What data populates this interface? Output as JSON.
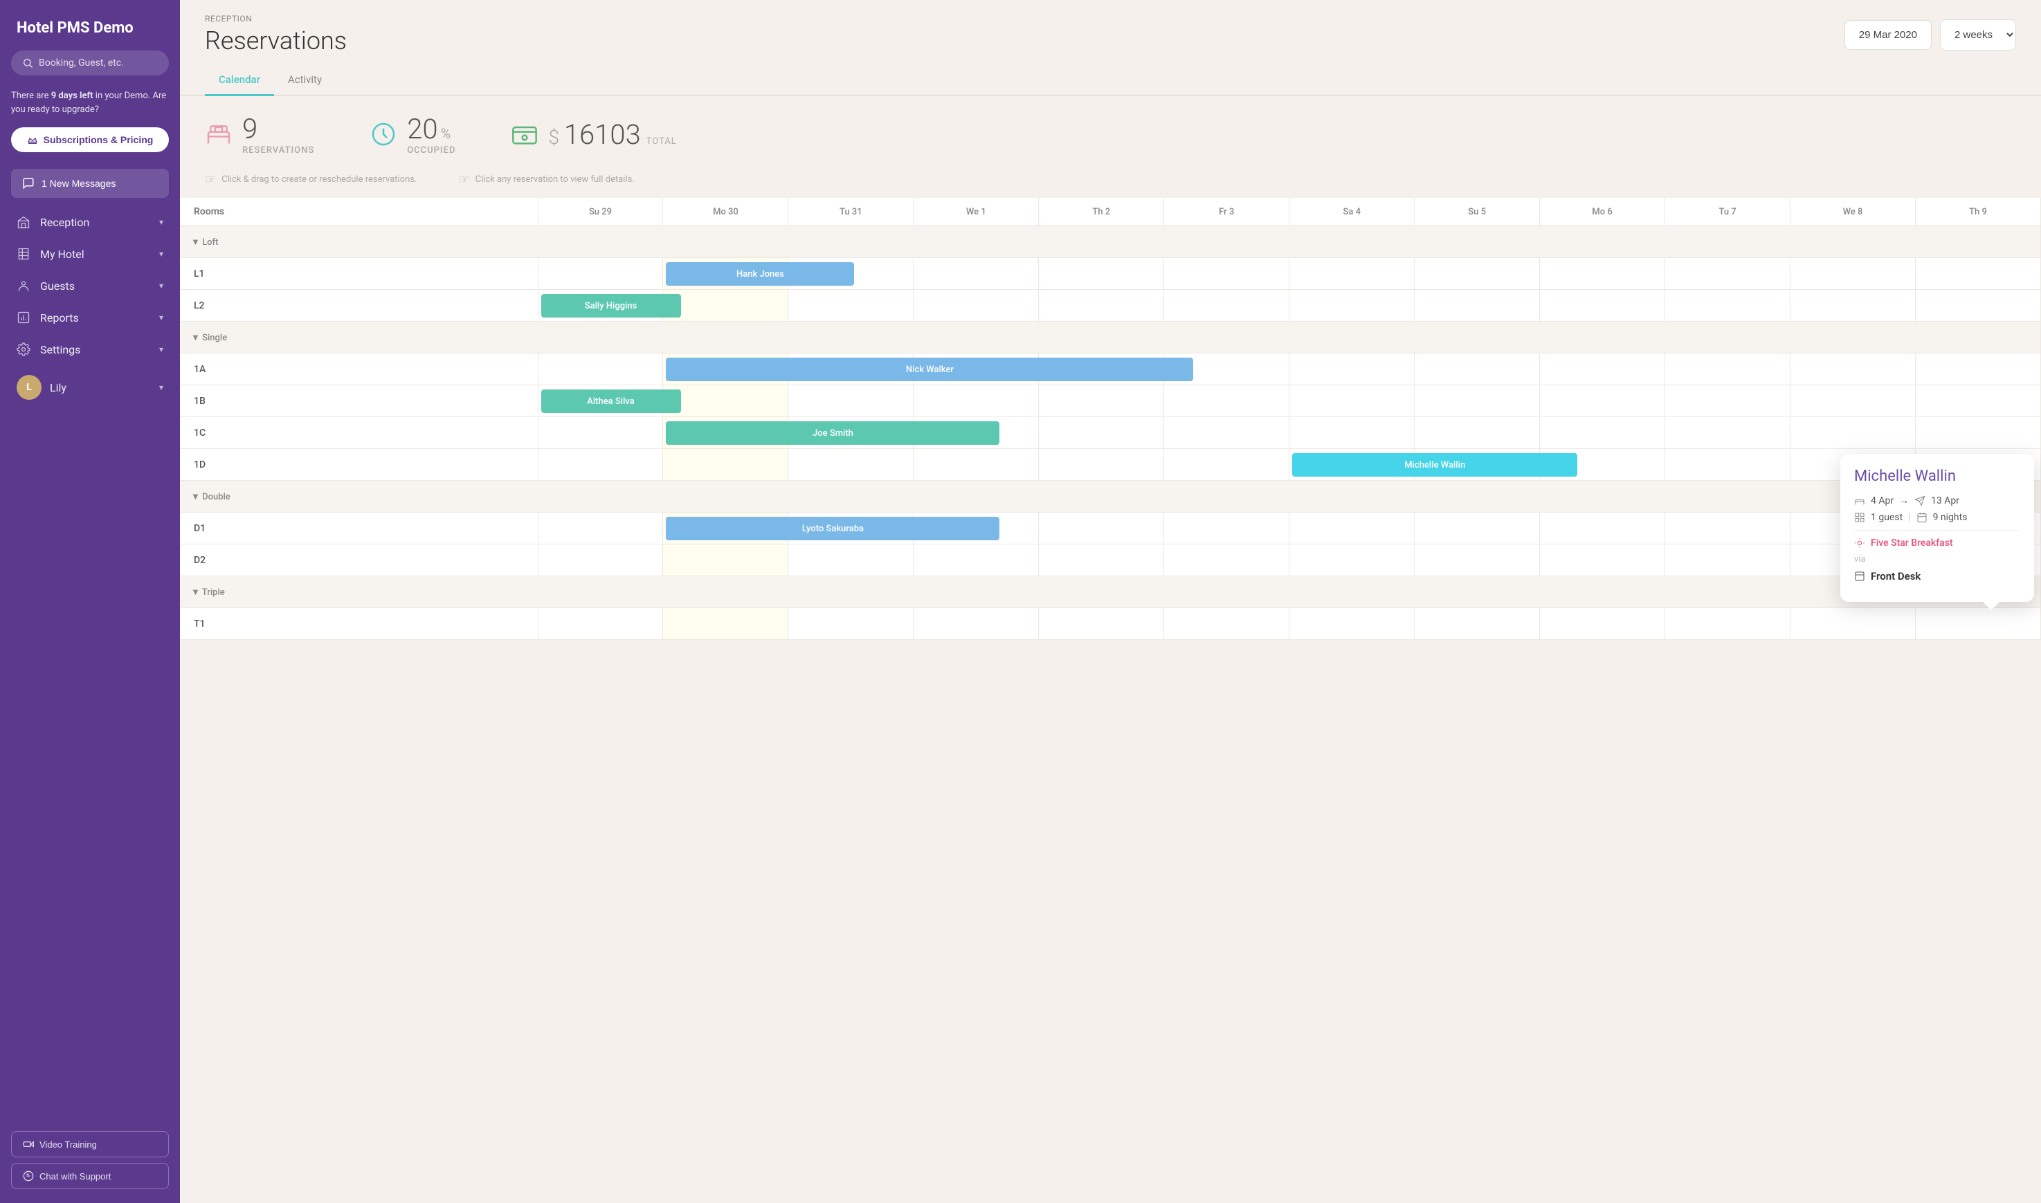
{
  "sidebar": {
    "title": "Hotel PMS Demo",
    "search_placeholder": "Booking, Guest, etc.",
    "demo_notice": "There are",
    "demo_days": "9 days left",
    "demo_notice2": "in your Demo. Are you ready to upgrade?",
    "upgrade_label": "Subscriptions & Pricing",
    "messages_label": "1 New Messages",
    "nav_items": [
      {
        "id": "reception",
        "label": "Reception",
        "icon": "hotel"
      },
      {
        "id": "my-hotel",
        "label": "My Hotel",
        "icon": "building"
      },
      {
        "id": "guests",
        "label": "Guests",
        "icon": "pin"
      },
      {
        "id": "reports",
        "label": "Reports",
        "icon": "chart"
      },
      {
        "id": "settings",
        "label": "Settings",
        "icon": "gear"
      }
    ],
    "user_name": "Lily",
    "video_training": "Video Training",
    "chat_support": "Chat with Support"
  },
  "header": {
    "breadcrumb": "RECEPTION",
    "title": "Reservations",
    "date": "29 Mar 2020",
    "weeks": "2 weeks"
  },
  "tabs": [
    {
      "id": "calendar",
      "label": "Calendar",
      "active": true
    },
    {
      "id": "activity",
      "label": "Activity",
      "active": false
    }
  ],
  "stats": {
    "reservations": {
      "number": "9",
      "label": "RESERVATIONS"
    },
    "occupied": {
      "number": "20",
      "unit": "%",
      "label": "OCCUPIED"
    },
    "total": {
      "symbol": "$",
      "number": "16103",
      "label": "TOTAL"
    }
  },
  "hints": [
    "Click & drag to create or reschedule reservations.",
    "Click any reservation to view full details."
  ],
  "calendar": {
    "rooms_header": "Rooms",
    "days": [
      {
        "label": "Su 29",
        "today": false
      },
      {
        "label": "Mo 30",
        "today": false
      },
      {
        "label": "Tu 31",
        "today": false
      },
      {
        "label": "We 1",
        "today": false
      },
      {
        "label": "Th 2",
        "today": false
      },
      {
        "label": "Fr 3",
        "today": false
      },
      {
        "label": "Sa 4",
        "today": false
      },
      {
        "label": "Su 5",
        "today": false
      },
      {
        "label": "Mo 6",
        "today": false
      },
      {
        "label": "Tu 7",
        "today": false
      },
      {
        "label": "We 8",
        "today": false
      },
      {
        "label": "Th 9",
        "today": false
      }
    ],
    "groups": [
      {
        "name": "▼ Loft",
        "rooms": [
          {
            "name": "L1",
            "reservation": {
              "guest": "Hank Jones",
              "color": "blue",
              "start": 1,
              "end": 5
            }
          },
          {
            "name": "L2",
            "reservation": {
              "guest": "Sally Higgins",
              "color": "teal",
              "start": 0,
              "end": 3
            }
          }
        ]
      },
      {
        "name": "▼ Single",
        "rooms": [
          {
            "name": "1A",
            "reservation": {
              "guest": "Nick Walker",
              "color": "blue",
              "start": 1,
              "end": 12
            }
          },
          {
            "name": "1B",
            "reservation": {
              "guest": "Althea Silva",
              "color": "teal",
              "start": 0,
              "end": 3
            }
          },
          {
            "name": "1C",
            "reservation": {
              "guest": "Joe Smith",
              "color": "teal",
              "start": 1,
              "end": 8
            }
          },
          {
            "name": "1D",
            "reservation": {
              "guest": "Michelle Wallin",
              "color": "cyan",
              "start": 6,
              "end": 12
            }
          }
        ]
      },
      {
        "name": "▼ Double",
        "rooms": [
          {
            "name": "D1",
            "reservation": {
              "guest": "Lyoto Sakuraba",
              "color": "blue",
              "start": 1,
              "end": 8
            }
          },
          {
            "name": "D2",
            "reservation": null
          }
        ]
      },
      {
        "name": "▼ Triple",
        "rooms": [
          {
            "name": "T1",
            "reservation": null
          }
        ]
      }
    ]
  },
  "tooltip": {
    "guest_name": "Michelle Wallin",
    "check_in": "4 Apr",
    "check_out": "13 Apr",
    "guests": "1 guest",
    "nights": "9 nights",
    "addon": "Five Star Breakfast",
    "via_label": "via",
    "source": "Front Desk"
  }
}
